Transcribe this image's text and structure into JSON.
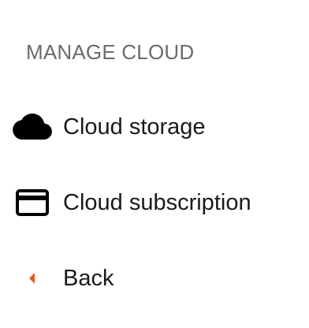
{
  "menu": {
    "section_title": "MANAGE CLOUD",
    "items": [
      {
        "label": "Cloud storage",
        "icon": "cloud-icon"
      },
      {
        "label": "Cloud subscription",
        "icon": "credit-card-icon"
      },
      {
        "label": "Back",
        "icon": "back-arrow-icon"
      }
    ]
  },
  "colors": {
    "header_text": "#6b6b6b",
    "item_text": "#1a1a1a",
    "icon": "#000000",
    "back_accent": "#e85a1f"
  }
}
